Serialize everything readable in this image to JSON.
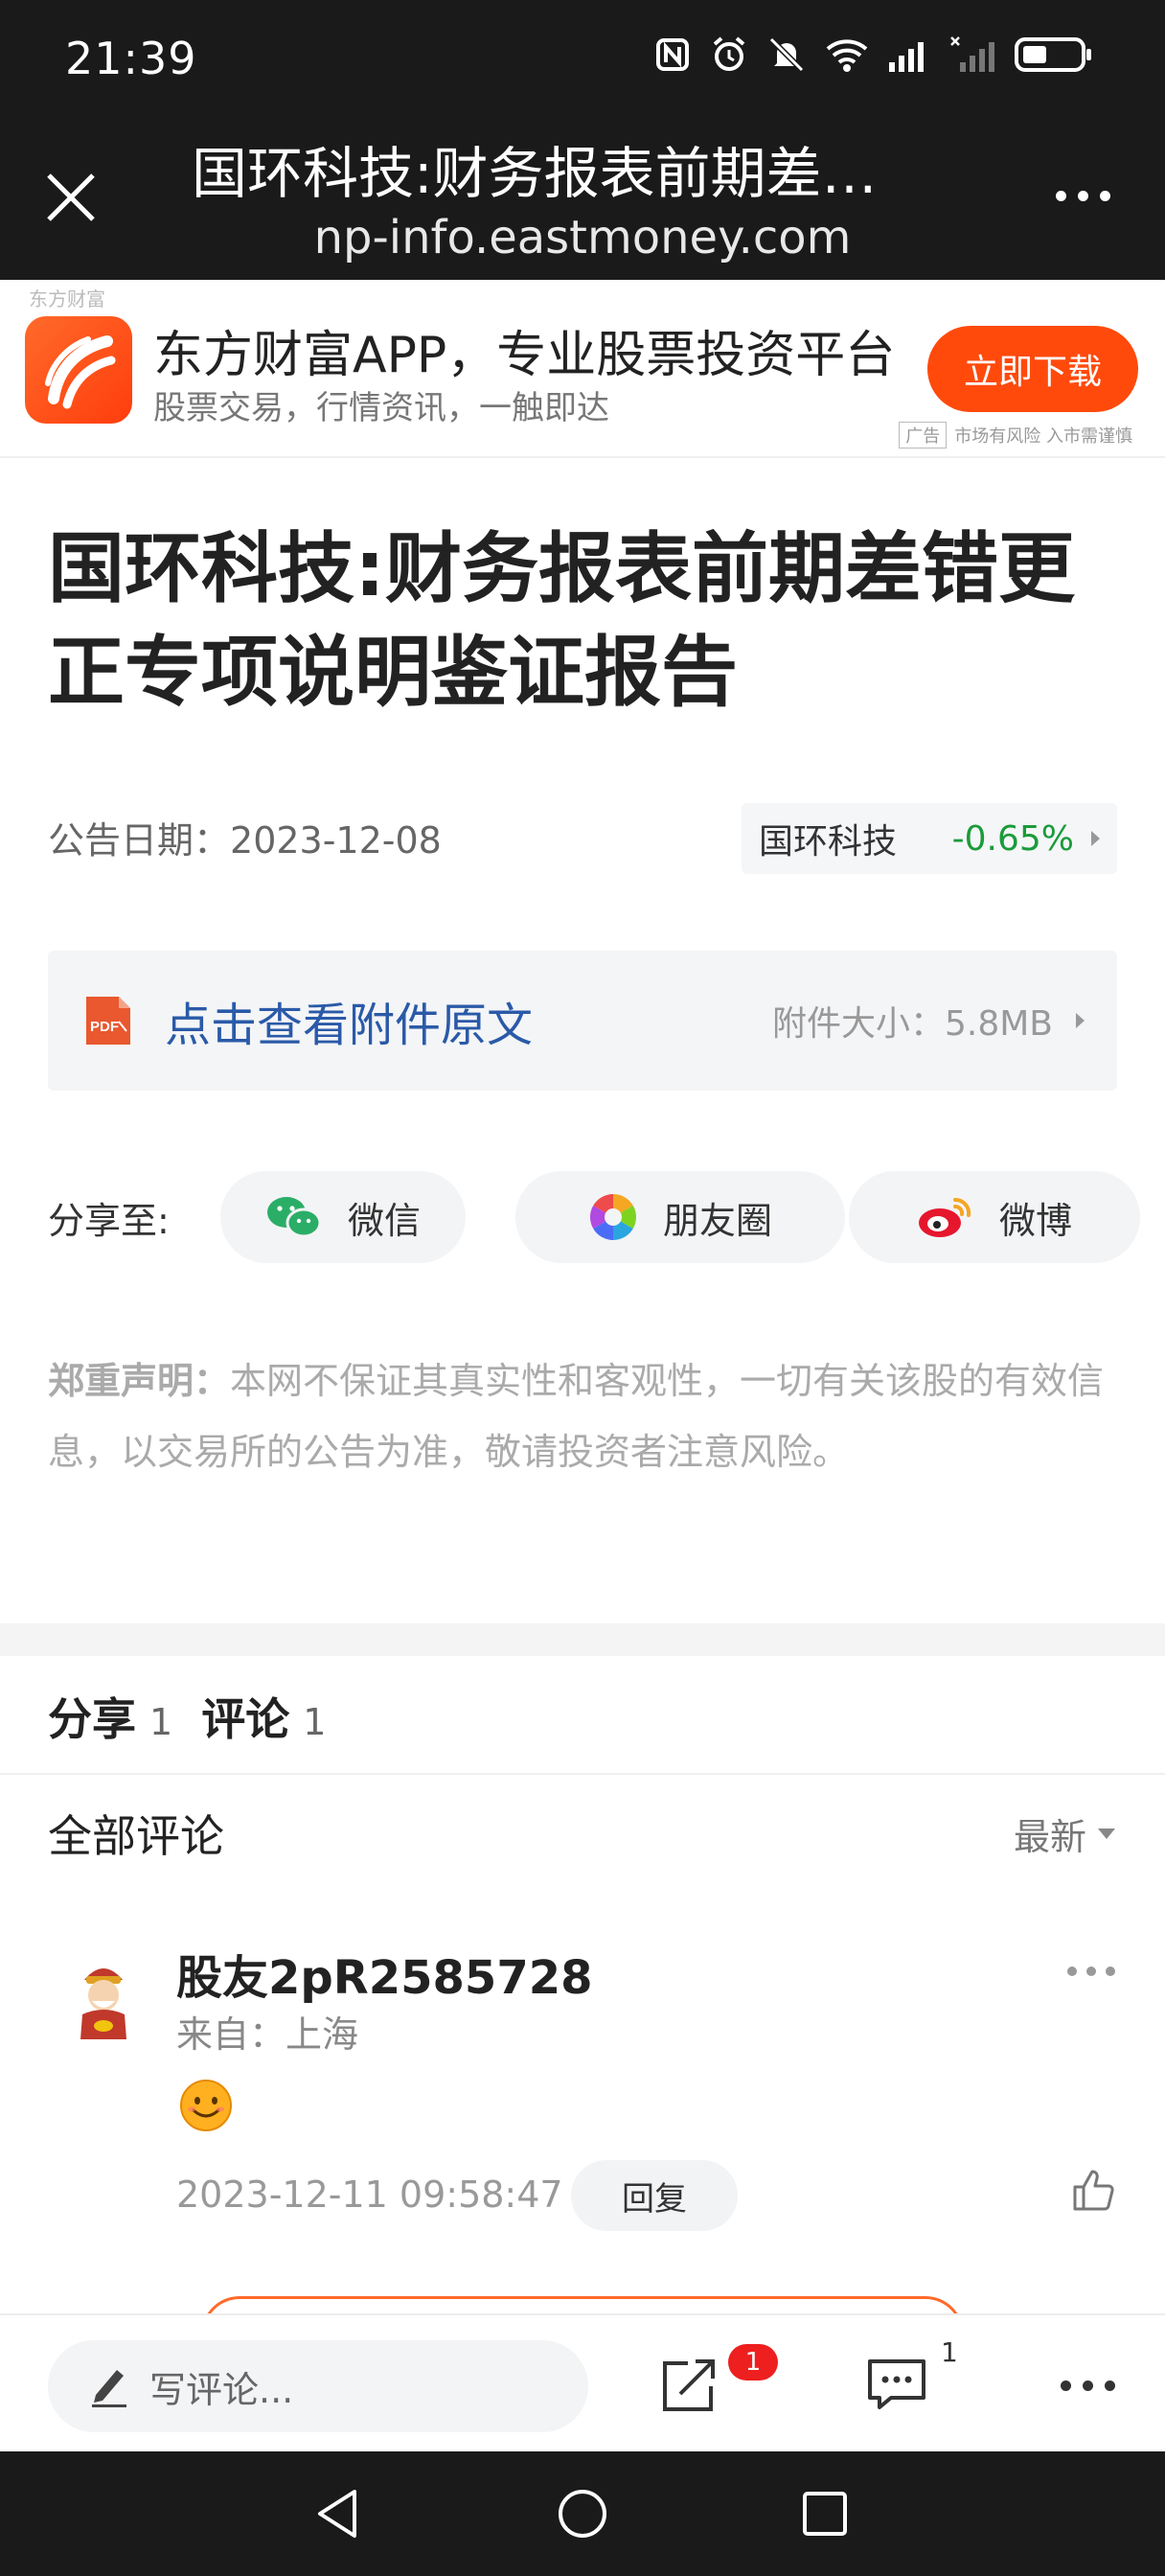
{
  "status_bar": {
    "time": "21:39",
    "icons": [
      "nfc-icon",
      "alarm-icon",
      "mute-icon",
      "wifi-icon",
      "signal-icon",
      "signal-no-sim-icon",
      "battery-icon"
    ]
  },
  "browser": {
    "title": "国环科技:财务报表前期差…",
    "url": "np-info.eastmoney.com"
  },
  "ad": {
    "brand_tiny": "东方财富",
    "title": "东方财富APP，专业股票投资平台",
    "subtitle": "股票交易，行情资讯，一触即达",
    "button": "立即下载",
    "tag": "广告",
    "risk": "市场有风险 入市需谨慎"
  },
  "article": {
    "title": "国环科技:财务报表前期差错更正专项说明鉴证报告",
    "date_label": "公告日期：",
    "date": "2023-12-08",
    "stock_name": "国环科技",
    "stock_change": "-0.65%",
    "stock_change_color": "#1a9b3a",
    "attachment_link": "点击查看附件原文",
    "attachment_size_label": "附件大小：",
    "attachment_size": "5.8MB",
    "share_label": "分享至:",
    "share_wechat": "微信",
    "share_moments": "朋友圈",
    "share_weibo": "微博",
    "disclaimer_label": "郑重声明：",
    "disclaimer_text": "本网不保证其真实性和客观性，一切有关该股的有效信息，以交易所的公告为准，敬请投资者注意风险。"
  },
  "tabs": {
    "share_label": "分享",
    "share_count": "1",
    "comment_label": "评论",
    "comment_count": "1"
  },
  "comments": {
    "header": "全部评论",
    "sort": "最新",
    "items": [
      {
        "user": "股友2pR2585728",
        "from": "来自：上海",
        "time": "2023-12-11 09:58:47",
        "reply": "回复"
      }
    ]
  },
  "bottom_bar": {
    "write_placeholder": "写评论...",
    "share_badge": "1",
    "comment_count": "1"
  },
  "colors": {
    "accent": "#ff4a0c",
    "link": "#2a5aa8",
    "negative": "#1a9b3a"
  }
}
